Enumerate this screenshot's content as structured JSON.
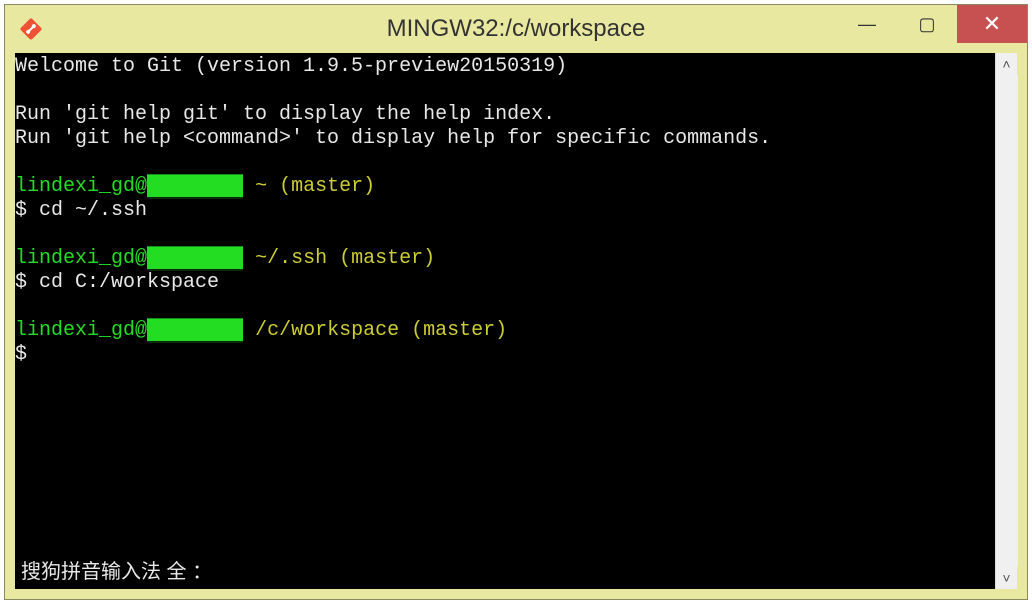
{
  "window": {
    "title": "MINGW32:/c/workspace"
  },
  "controls": {
    "minimize_glyph": "—",
    "maximize_glyph": "▢",
    "close_glyph": "✕"
  },
  "terminal": {
    "welcome_line": "Welcome to Git (version 1.9.5-preview20150319)",
    "help_line1": "Run 'git help git' to display the help index.",
    "help_line2": "Run 'git help <command>' to display help for specific commands.",
    "user_prefix": "lindexi_gd@",
    "host_redacted": "████████",
    "prompt1_path": "~",
    "prompt1_branch": "(master)",
    "cmd1": "$ cd ~/.ssh",
    "prompt2_path": "~/.ssh",
    "prompt2_branch": "(master)",
    "cmd2": "$ cd C:/workspace",
    "prompt3_path": "/c/workspace",
    "prompt3_branch": "(master)",
    "cmd3": "$"
  },
  "ime": {
    "text": "搜狗拼音输入法 全 ："
  },
  "scrollbar": {
    "up_glyph": "˄",
    "down_glyph": "˅"
  }
}
